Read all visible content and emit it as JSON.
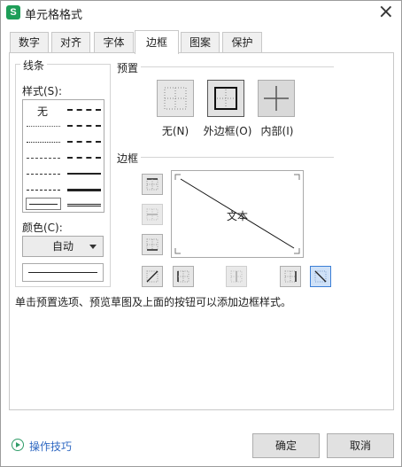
{
  "window": {
    "title": "单元格格式",
    "app_icon_letter": "S"
  },
  "tabs": [
    {
      "label": "数字",
      "active": false
    },
    {
      "label": "对齐",
      "active": false
    },
    {
      "label": "字体",
      "active": false
    },
    {
      "label": "边框",
      "active": true
    },
    {
      "label": "图案",
      "active": false
    },
    {
      "label": "保护",
      "active": false
    }
  ],
  "line_section": {
    "title": "线条",
    "style_label": "样式(S):",
    "none_label": "无",
    "color_label": "颜色(C):",
    "color_value": "自动"
  },
  "presets": {
    "title": "预置",
    "items": [
      {
        "label": "无(N)",
        "icon": "border-none-icon"
      },
      {
        "label": "外边框(O)",
        "icon": "border-outline-icon"
      },
      {
        "label": "内部(I)",
        "icon": "border-inside-icon"
      }
    ]
  },
  "border": {
    "title": "边框",
    "preview_text": "文本"
  },
  "hint": "单击预置选项、预览草图及上面的按钮可以添加边框样式。",
  "footer": {
    "help_label": "操作技巧",
    "ok_label": "确定",
    "cancel_label": "取消"
  },
  "colors": {
    "accent_selected": "#3c7fd6",
    "link": "#2f68c2",
    "app_icon": "#1e9e58"
  }
}
